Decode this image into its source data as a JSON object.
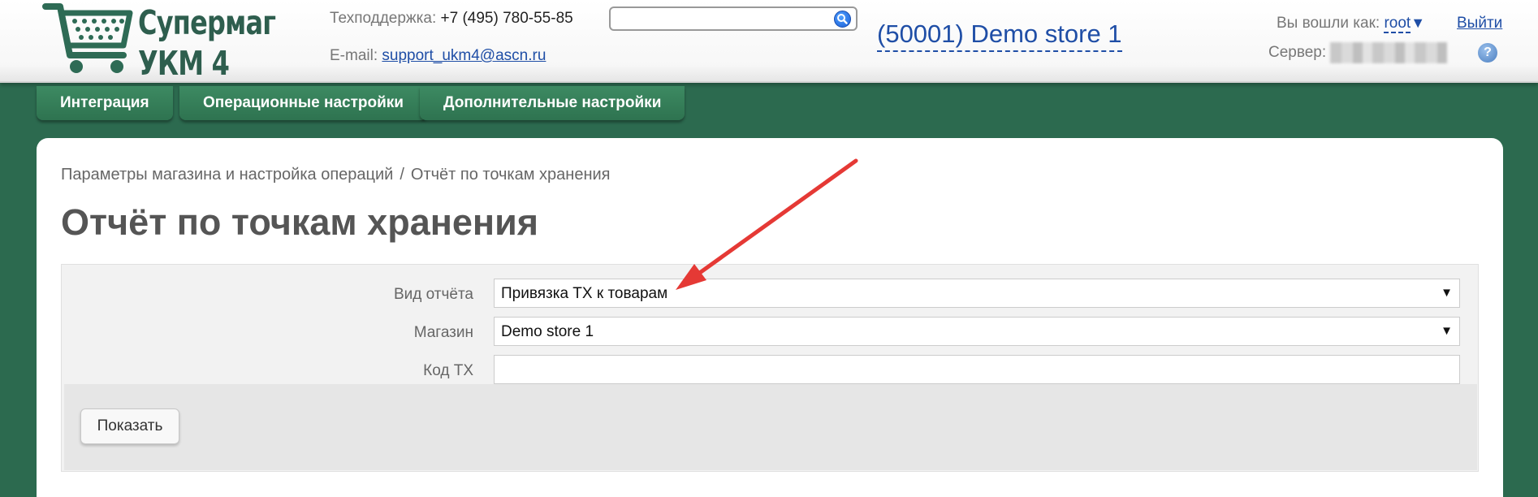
{
  "header": {
    "logo": {
      "line1": "Супермаг",
      "line2": "УКМ 4"
    },
    "support": {
      "label": "Техподдержка:",
      "phone": "+7 (495) 780-55-85"
    },
    "email": {
      "label": "E-mail:",
      "address": "support_ukm4@ascn.ru"
    },
    "search": {
      "value": ""
    },
    "store": "(50001) Demo store 1",
    "user": {
      "label": "Вы вошли как:",
      "name": "root",
      "caret": "▼"
    },
    "logout": "Выйти",
    "server": {
      "label": "Сервер:"
    },
    "help": "?"
  },
  "tabs": [
    {
      "label": "Интеграция"
    },
    {
      "label": "Операционные настройки"
    },
    {
      "label": "Дополнительные настройки"
    }
  ],
  "breadcrumb": {
    "parent": "Параметры магазина и настройка операций",
    "separator": "/",
    "current": "Отчёт по точкам хранения"
  },
  "page_title": "Отчёт по точкам хранения",
  "form": {
    "report_type": {
      "label": "Вид отчёта",
      "value": "Привязка ТХ к товарам"
    },
    "store": {
      "label": "Магазин",
      "value": "Demo store 1"
    },
    "storage_code": {
      "label": "Код ТХ",
      "value": ""
    },
    "dropdown_glyph": "▼",
    "show_button": "Показать"
  },
  "colors": {
    "brand_green": "#2c6a4f",
    "link_blue": "#1f4ea6",
    "annotation_arrow": "#e53935"
  }
}
